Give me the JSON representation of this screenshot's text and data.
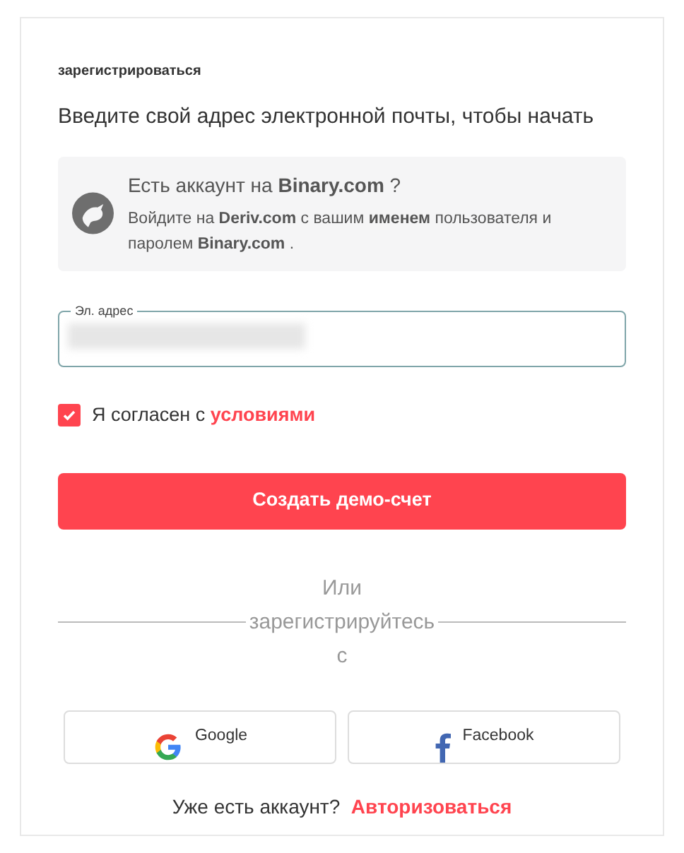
{
  "header": {
    "small_title": "зарегистрироваться",
    "heading": "Введите свой адрес электронной почты, чтобы начать"
  },
  "notice": {
    "title": "Есть аккаунт на **Binary.com** ?",
    "text": "Войдите на **Deriv.com** с вашим **именем** пользователя и паролем **Binary.com** ."
  },
  "email_field": {
    "label": "Эл. адрес",
    "value_redacted": true
  },
  "terms": {
    "checked": true,
    "text": "Я согласен с",
    "link": "условиями"
  },
  "submit_button": "Создать демо-счет",
  "divider": {
    "text": "Или зарегистрируйтесь с"
  },
  "social_buttons": [
    {
      "kind": "google",
      "label": "Google"
    },
    {
      "kind": "facebook",
      "label": "Facebook"
    }
  ],
  "footer": {
    "text": "Уже есть аккаунт?",
    "link": "Авторизоваться"
  }
}
